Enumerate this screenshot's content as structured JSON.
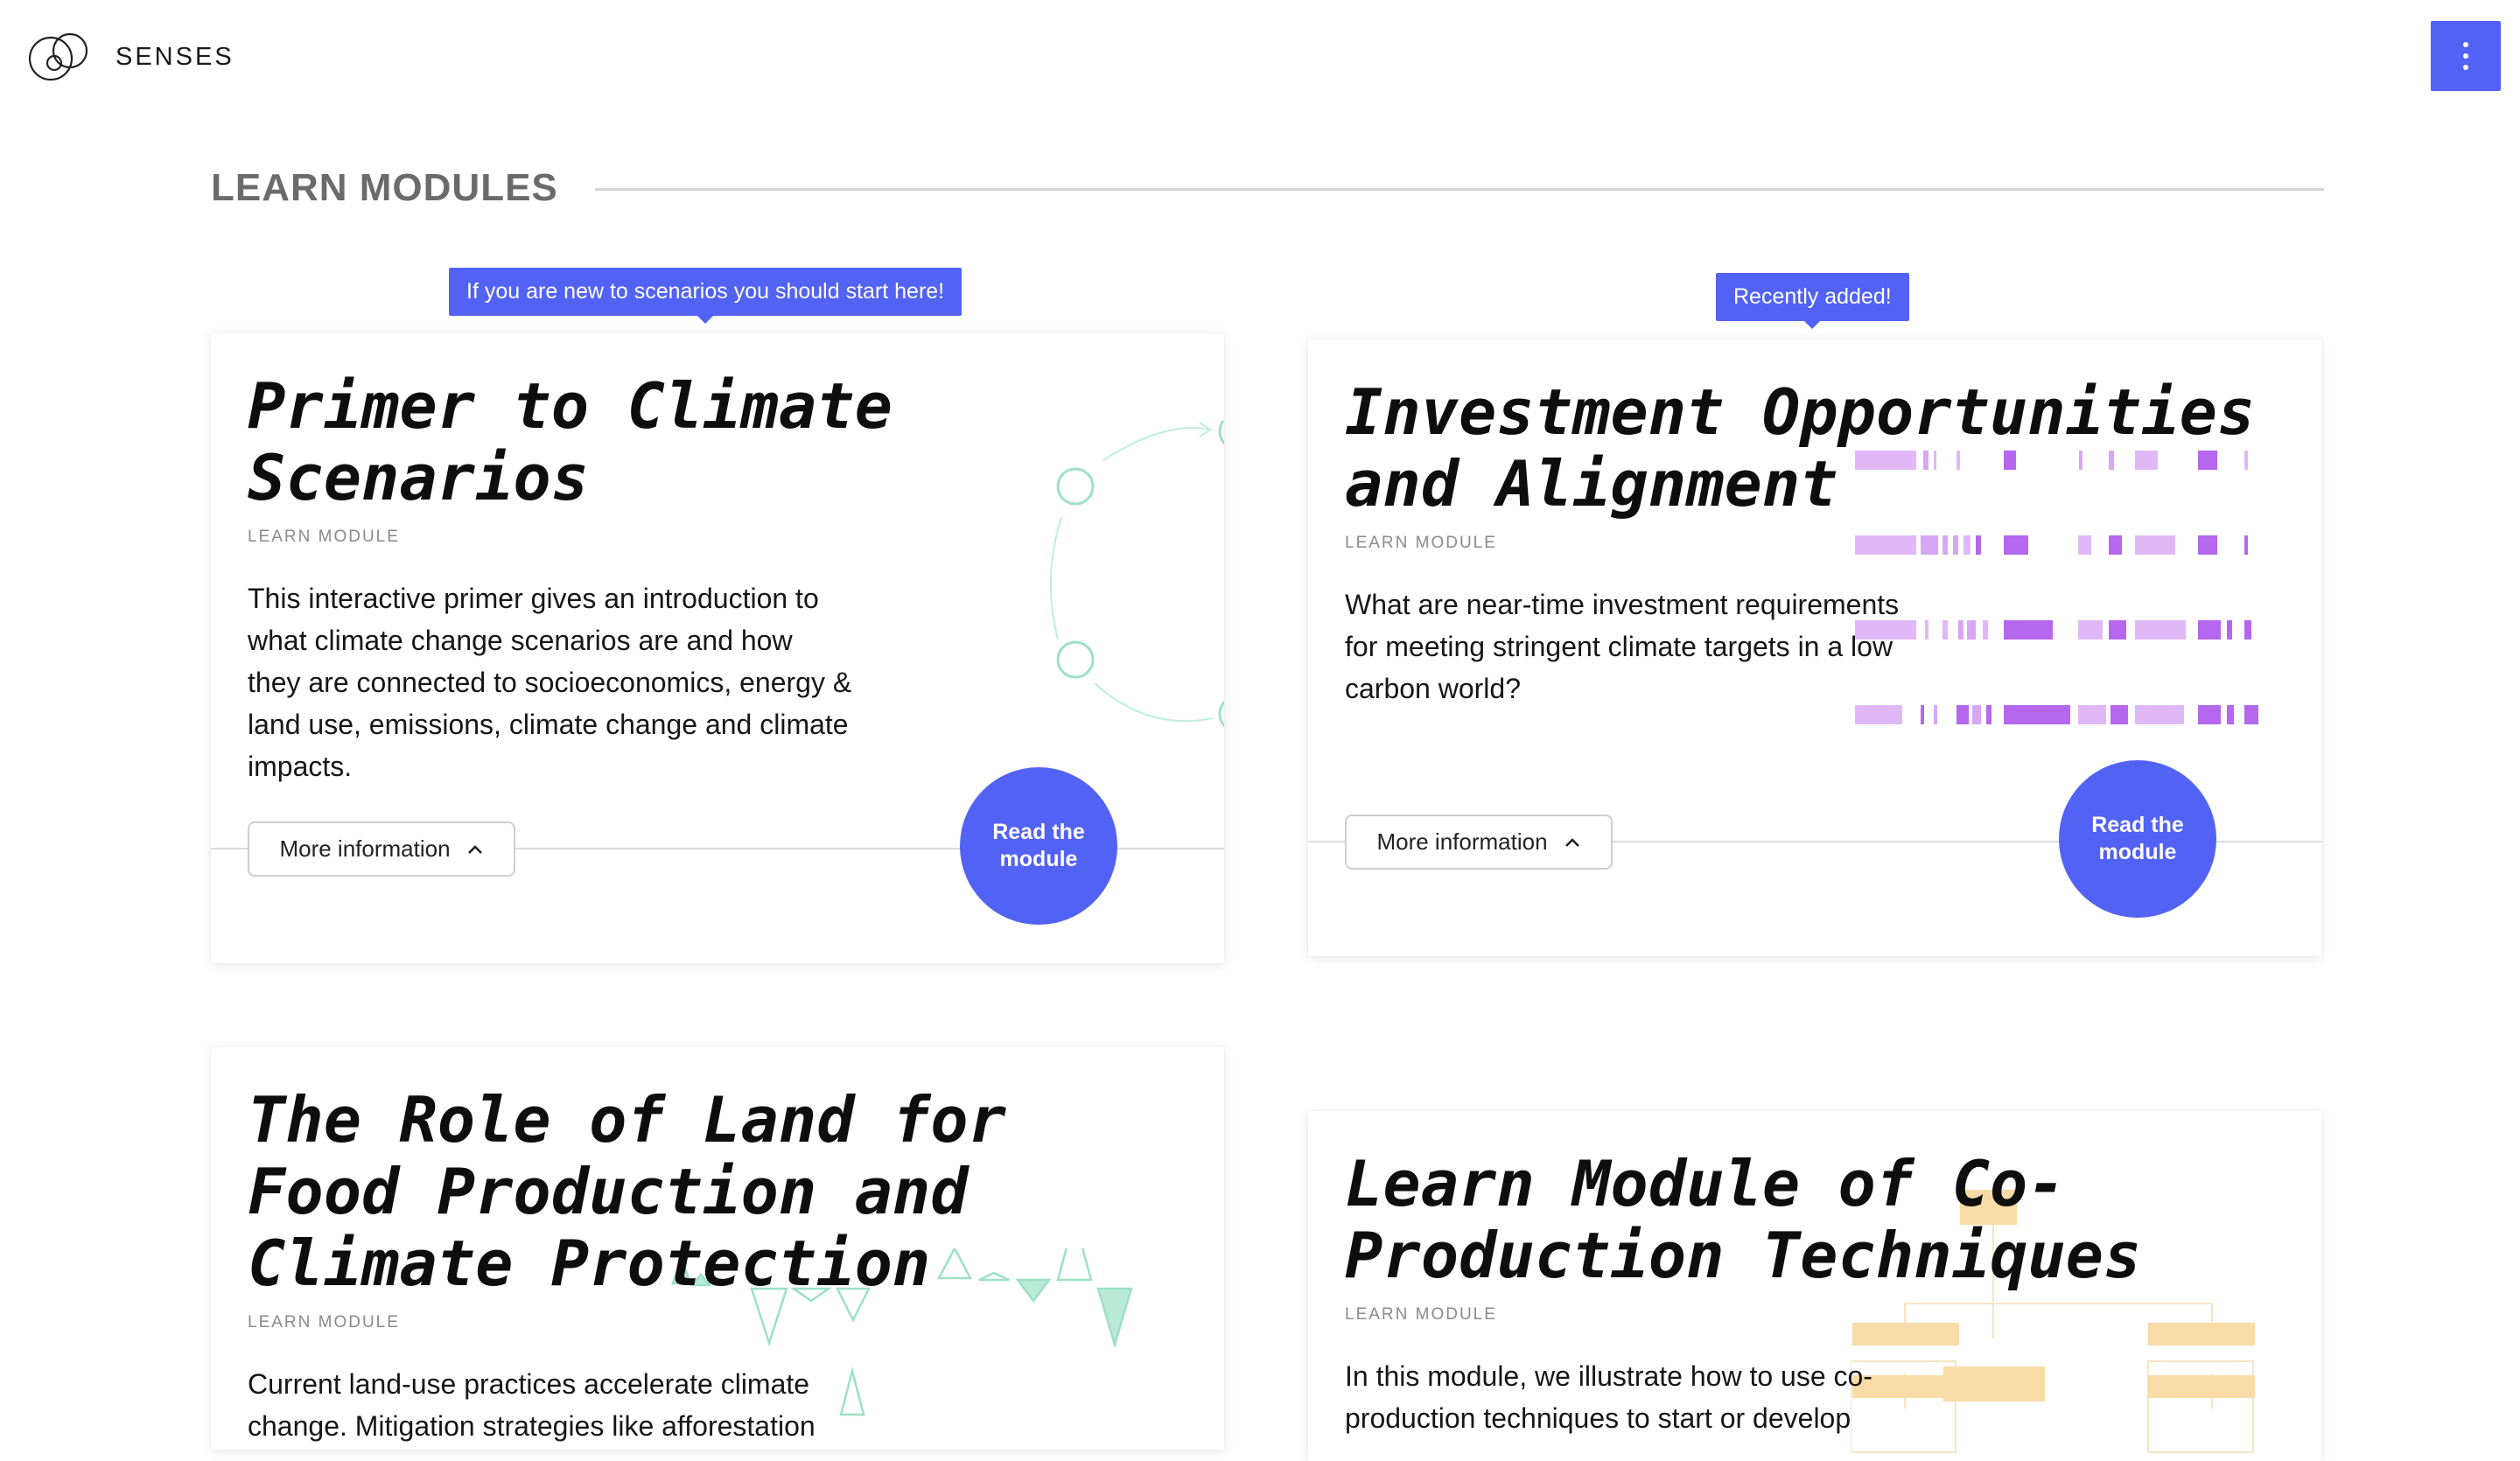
{
  "header": {
    "logo_text": "SENSES",
    "logo_icon": "interlocking-circles-logo",
    "menu_icon": "vertical-dots-icon"
  },
  "section": {
    "title": "LEARN MODULES"
  },
  "callouts": {
    "primer": "If you are new to scenarios you should start here!",
    "investment": "Recently added!"
  },
  "colors": {
    "accent": "#5262f4",
    "green": "#9de0c5",
    "purple": "#b567f0",
    "yellow": "#f8dba6"
  },
  "cards": [
    {
      "title_lines": [
        "Primer to Climate",
        "Scenarios"
      ],
      "kicker": "LEARN MODULE",
      "desc_lines": [
        "This interactive primer gives an introduction to",
        "what climate change scenarios are and how",
        "they are connected to socioeconomics, energy &",
        "land use, emissions, climate change and climate",
        "impacts."
      ],
      "more_label": "More information",
      "read_lines": [
        "Read the",
        "module"
      ]
    },
    {
      "title_lines": [
        "Investment Opportunities",
        "and Alignment"
      ],
      "kicker": "LEARN MODULE",
      "desc_lines": [
        "What are near-time investment requirements",
        "for meeting stringent climate targets in a low",
        "carbon world?"
      ],
      "more_label": "More information",
      "read_lines": [
        "Read the",
        "module"
      ]
    },
    {
      "title_lines": [
        "The Role of Land for",
        "Food Production and",
        "Climate Protection"
      ],
      "kicker": "LEARN MODULE",
      "desc_lines": [
        "Current land-use practices accelerate climate",
        "change. Mitigation strategies like afforestation"
      ]
    },
    {
      "title_lines": [
        "Learn Module of Co-",
        "Production Techniques"
      ],
      "kicker": "LEARN MODULE",
      "desc_lines": [
        "In this module, we illustrate how to use co-",
        "production techniques to start or develop"
      ]
    }
  ]
}
